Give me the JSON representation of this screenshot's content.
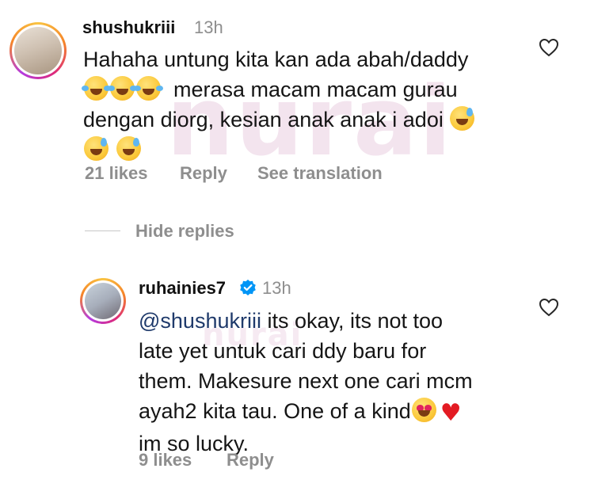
{
  "watermark": {
    "text": "nurai"
  },
  "comments": [
    {
      "username": "shushukriii",
      "time": "13h",
      "text_parts": [
        "Hahaha untung kita kan ada abah/daddy",
        "merasa macam macam gurau",
        "dengan diorg, kesian anak anak i adoi"
      ],
      "emojis": [
        "face-with-tears-of-joy",
        "face-with-tears-of-joy",
        "face-with-tears-of-joy",
        "grinning-face-with-sweat",
        "grinning-face-with-sweat",
        "grinning-face-with-sweat"
      ],
      "likes": "21 likes",
      "reply_label": "Reply",
      "translate_label": "See translation",
      "hide_replies_label": "Hide replies"
    }
  ],
  "reply": {
    "username": "ruhainies7",
    "verified": true,
    "time": "13h",
    "mention": "@shushukriii",
    "line1_rest": " its okay, its not too",
    "line2": "late yet untuk cari ddy baru for",
    "line3": "them. Makesure next one cari mcm",
    "line4": "ayah2 kita tau. One of a kind",
    "line5": "im so lucky.",
    "emojis": [
      "smiling-face-with-heart-eyes",
      "red-heart"
    ],
    "likes": "9 likes",
    "reply_label": "Reply"
  },
  "colors": {
    "meta_gray": "#8e8e8e",
    "mention_blue": "#1f3a6b",
    "verified_blue": "#0095f6",
    "heart_red": "#e31b23"
  }
}
